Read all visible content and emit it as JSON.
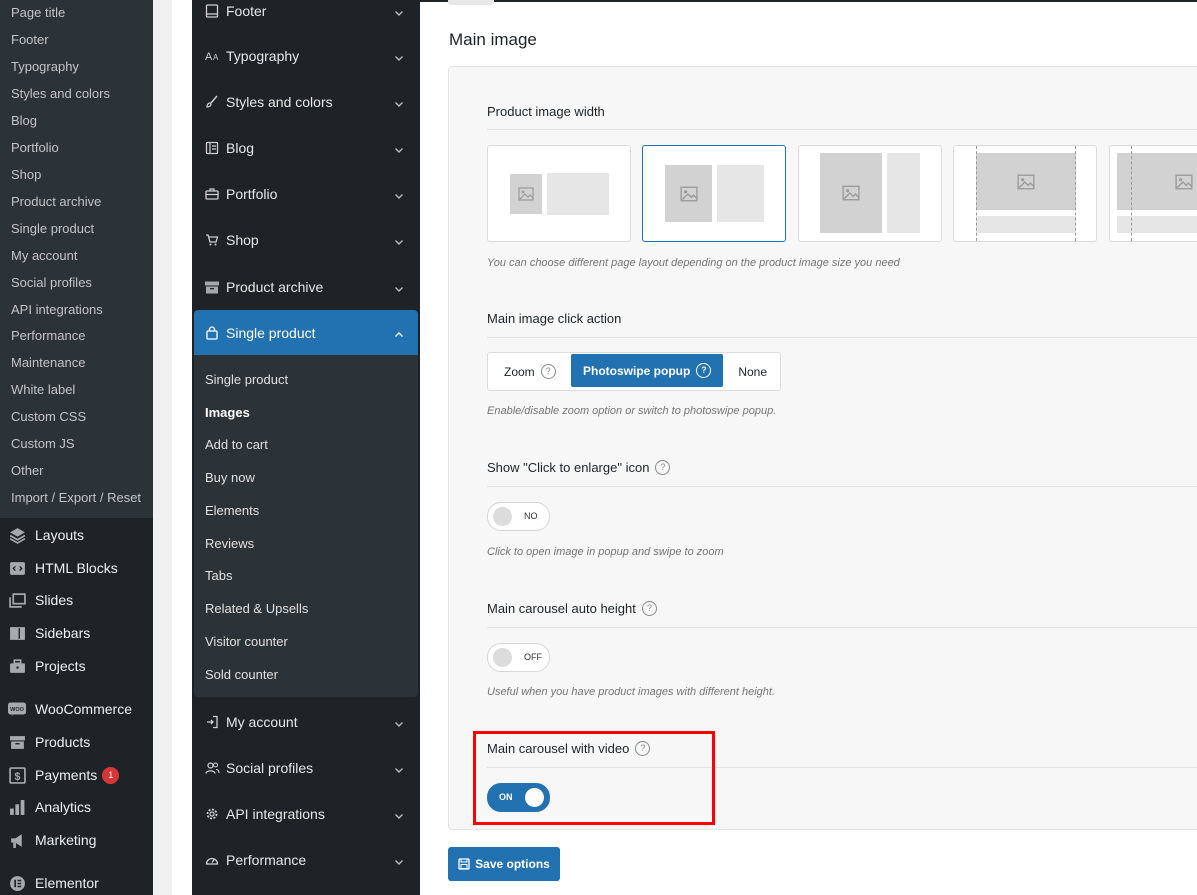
{
  "wp_submenu": [
    "Page title",
    "Footer",
    "Typography",
    "Styles and colors",
    "Blog",
    "Portfolio",
    "Shop",
    "Product archive",
    "Single product",
    "My account",
    "Social profiles",
    "API integrations",
    "Performance",
    "Maintenance",
    "White label",
    "Custom CSS",
    "Custom JS",
    "Other",
    "Import / Export / Reset"
  ],
  "wp_menu": [
    {
      "label": "Layouts",
      "icon": "layers-icon"
    },
    {
      "label": "HTML Blocks",
      "icon": "code-icon"
    },
    {
      "label": "Slides",
      "icon": "images-icon"
    },
    {
      "label": "Sidebars",
      "icon": "sidebar-icon"
    },
    {
      "label": "Projects",
      "icon": "briefcase-icon"
    },
    {
      "label": "WooCommerce",
      "icon": "woo-icon"
    },
    {
      "label": "Products",
      "icon": "archive-icon"
    },
    {
      "label": "Payments",
      "icon": "dollar-icon",
      "badge": "1"
    },
    {
      "label": "Analytics",
      "icon": "bar-chart-icon"
    },
    {
      "label": "Marketing",
      "icon": "megaphone-icon"
    },
    {
      "label": "Elementor",
      "icon": "elementor-icon"
    }
  ],
  "theme_nav": [
    {
      "label": "Footer",
      "icon": "footer-icon"
    },
    {
      "label": "Typography",
      "icon": "typography-icon"
    },
    {
      "label": "Styles and colors",
      "icon": "brush-icon"
    },
    {
      "label": "Blog",
      "icon": "blog-icon"
    },
    {
      "label": "Portfolio",
      "icon": "portfolio-icon"
    },
    {
      "label": "Shop",
      "icon": "cart-icon"
    },
    {
      "label": "Product archive",
      "icon": "archive-icon"
    },
    {
      "label": "Single product",
      "icon": "bag-icon",
      "active": true
    },
    {
      "label": "My account",
      "icon": "login-icon"
    },
    {
      "label": "Social profiles",
      "icon": "users-icon"
    },
    {
      "label": "API integrations",
      "icon": "gear-icon"
    },
    {
      "label": "Performance",
      "icon": "speedometer-icon"
    }
  ],
  "theme_subnav": [
    "Single product",
    "Images",
    "Add to cart",
    "Buy now",
    "Elements",
    "Reviews",
    "Tabs",
    "Related & Upsells",
    "Visitor counter",
    "Sold counter"
  ],
  "theme_subnav_active": "Images",
  "section_title": "Main image",
  "options": {
    "image_width": {
      "label": "Product image width",
      "hint": "You can choose different page layout depending on the product image size you need",
      "selected_index": 1
    },
    "click_action": {
      "label": "Main image click action",
      "choices": [
        "Zoom",
        "Photoswipe popup",
        "None"
      ],
      "selected": "Photoswipe popup",
      "hint": "Enable/disable zoom option or switch to photoswipe popup."
    },
    "enlarge_icon": {
      "label": "Show \"Click to enlarge\" icon",
      "toggle": "NO",
      "hint": "Click to open image in popup and swipe to zoom"
    },
    "auto_height": {
      "label": "Main carousel auto height",
      "toggle": "OFF",
      "hint": "Useful when you have product images with different height."
    },
    "with_video": {
      "label": "Main carousel with video",
      "toggle": "ON"
    }
  },
  "save_button": "Save options",
  "colors": {
    "accent": "#2271b1",
    "highlight": "#ff0000",
    "sidebar": "#1d2327"
  }
}
